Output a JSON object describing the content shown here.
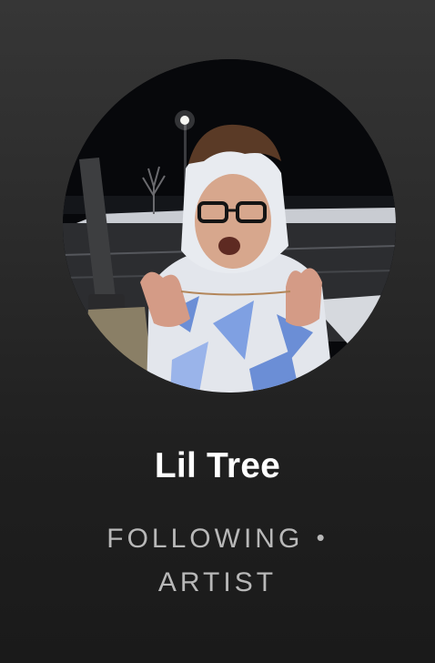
{
  "profile": {
    "name": "Lil Tree",
    "status": "FOLLOWING",
    "separator": "•",
    "type": "ARTIST",
    "avatar_icon": "artist-photo"
  },
  "colors": {
    "background_top": "#363636",
    "background_bottom": "#1a1a1a",
    "name_text": "#ffffff",
    "meta_text": "#b8b8b8"
  }
}
